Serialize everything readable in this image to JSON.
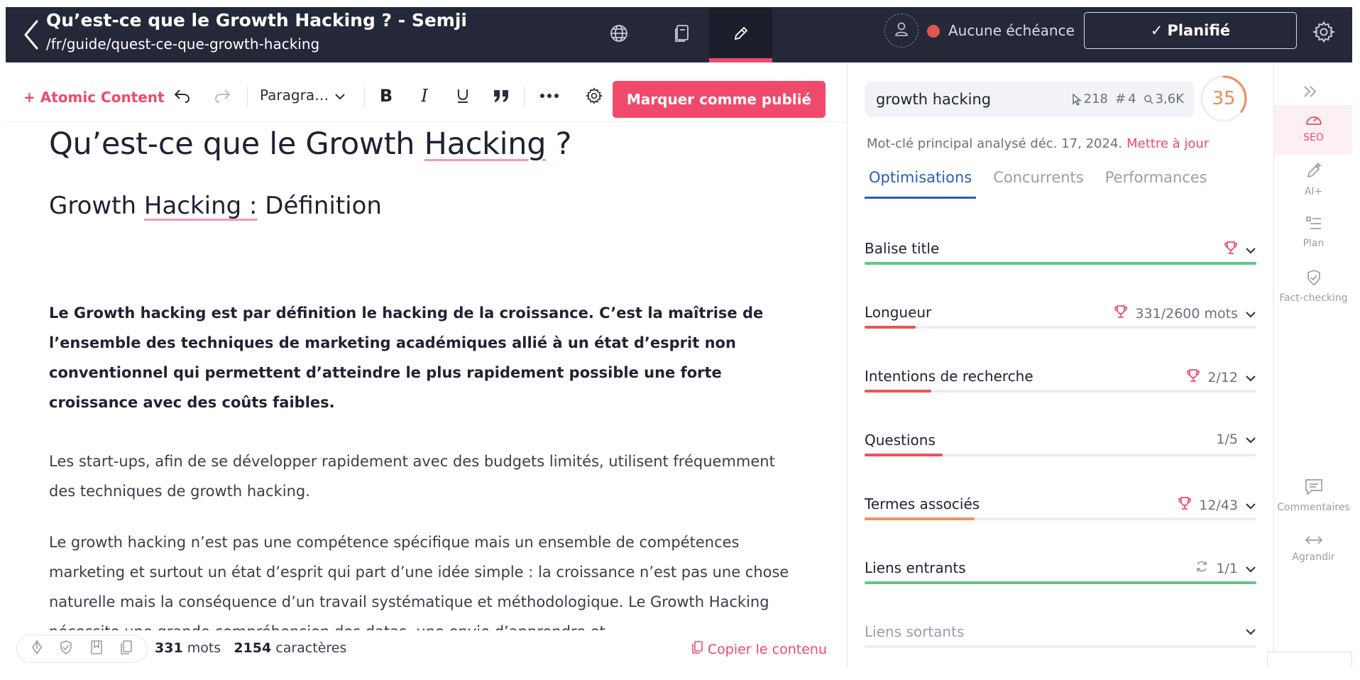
{
  "header": {
    "title": "Qu’est-ce que le Growth Hacking ? - Semji",
    "url": "/fr/guide/quest-ce-que-growth-hacking",
    "tabs": [
      {
        "icon": "globe-icon"
      },
      {
        "icon": "document-icon"
      },
      {
        "icon": "pencil-icon",
        "active": true
      }
    ],
    "due_label": "Aucune échéance",
    "due_color": "#e0574b",
    "status_label": "Planifié"
  },
  "toolbar": {
    "atomic_label": "Atomic Content",
    "paragraph_label": "Paragra…",
    "publish_label": "Marquer comme publié"
  },
  "article": {
    "h1_a": "Qu’est-ce que le Growth ",
    "h1_b": "Hacking",
    "h1_c": " ?",
    "h2_a": "Growth ",
    "h2_b": "Hacking :",
    "h2_c": " Définition",
    "p1": "Le Growth hacking est par définition le hacking de la croissance. C’est la maîtrise de l’ensemble des techniques de marketing académiques allié à un état d’esprit non conventionnel qui permettent d’atteindre le plus rapidement possible une forte croissance avec des coûts faibles.",
    "p2": "Les start-ups, afin de se développer rapidement avec des budgets limités, utilisent fréquemment des techniques de growth hacking.",
    "p3": "Le growth hacking n’est pas une compétence spécifique mais un ensemble de compétences marketing et surtout un état d’esprit qui part d’une idée simple : la croissance n’est pas une chose naturelle mais la conséquence d’un travail systématique et méthodologique. Le Growth Hacking nécessite une grande compréhension des datas, une envie d’apprendre et"
  },
  "footer": {
    "word_count": "331",
    "word_label": "mots",
    "char_count": "2154",
    "char_label": "caractères",
    "copy_label": "Copier le contenu"
  },
  "seo": {
    "keyword": "growth hacking",
    "clicks": "218",
    "rank": "4",
    "volume": "3,6K",
    "score": "35",
    "score_fraction": 0.35,
    "analyzed_text": "Mot-clé principal analysé déc. 17, 2024.",
    "update_label": "Mettre à jour",
    "tabs": [
      "Optimisations",
      "Concurrents",
      "Performances"
    ],
    "criteria": [
      {
        "label": "Balise title",
        "value": "",
        "progress": 1.0,
        "color": "#5cc98a",
        "trophy": true
      },
      {
        "label": "Longueur",
        "value": "331/2600 mots",
        "progress": 0.13,
        "color": "#ef5350",
        "trophy": true
      },
      {
        "label": "Intentions de recherche",
        "value": "2/12",
        "progress": 0.17,
        "color": "#ef5350",
        "trophy": true
      },
      {
        "label": "Questions",
        "value": "1/5",
        "progress": 0.2,
        "color": "#ef5350",
        "trophy": false
      },
      {
        "label": "Termes associés",
        "value": "12/43",
        "progress": 0.28,
        "color": "#f0925a",
        "trophy": true
      },
      {
        "label": "Liens entrants",
        "value": "1/1",
        "progress": 1.0,
        "color": "#5cc98a",
        "trophy": false,
        "refresh": true
      },
      {
        "label": "Liens sortants",
        "value": "",
        "progress": 0,
        "color": "#eceef2",
        "trophy": false,
        "muted": true
      }
    ]
  },
  "rail": {
    "items": [
      "SEO",
      "AI+",
      "Plan",
      "Fact-checking",
      "Commentaires",
      "Agrandir"
    ]
  }
}
